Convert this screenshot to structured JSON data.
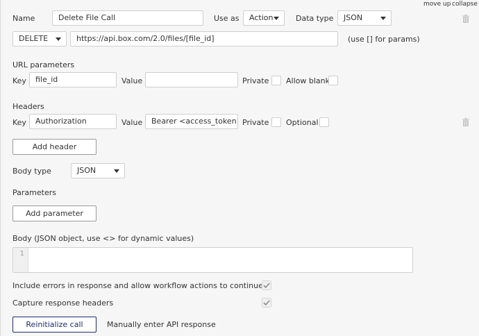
{
  "header": {
    "move_up": "move up",
    "collapse": "collapse"
  },
  "call": {
    "name_label": "Name",
    "name_value": "Delete File Call",
    "use_as_label": "Use as",
    "use_as_value": "Action",
    "data_type_label": "Data type",
    "data_type_value": "JSON",
    "method_value": "DELETE",
    "url_value": "https://api.box.com/2.0/files/[file_id]",
    "url_hint": "(use [] for params)"
  },
  "url_params": {
    "title": "URL parameters",
    "key_label": "Key",
    "key_value": "file_id",
    "value_label": "Value",
    "value_value": "",
    "private_label": "Private",
    "allow_blank_label": "Allow blank"
  },
  "headers": {
    "title": "Headers",
    "key_label": "Key",
    "key_value": "Authorization",
    "value_label": "Value",
    "value_value": "Bearer <access_token>",
    "private_label": "Private",
    "optional_label": "Optional",
    "add_header_label": "Add header"
  },
  "body": {
    "body_type_label": "Body type",
    "body_type_value": "JSON",
    "parameters_title": "Parameters",
    "add_parameter_label": "Add parameter",
    "body_label": "Body (JSON object, use <> for dynamic values)",
    "line_number": "1",
    "body_value": ""
  },
  "options": {
    "include_errors_label": "Include errors in response and allow workflow actions to continue",
    "include_errors_checked": true,
    "capture_headers_label": "Capture response headers",
    "capture_headers_checked": true
  },
  "footer": {
    "reinitialize_label": "Reinitialize call",
    "manual_response_label": "Manually enter API response"
  },
  "colors": {
    "panel_bg": "#f6f6f6",
    "primary_border": "#1d2b6b",
    "text": "#333333"
  },
  "icons": [
    "trash-icon",
    "chevron-down-icon",
    "checkmark-icon"
  ]
}
